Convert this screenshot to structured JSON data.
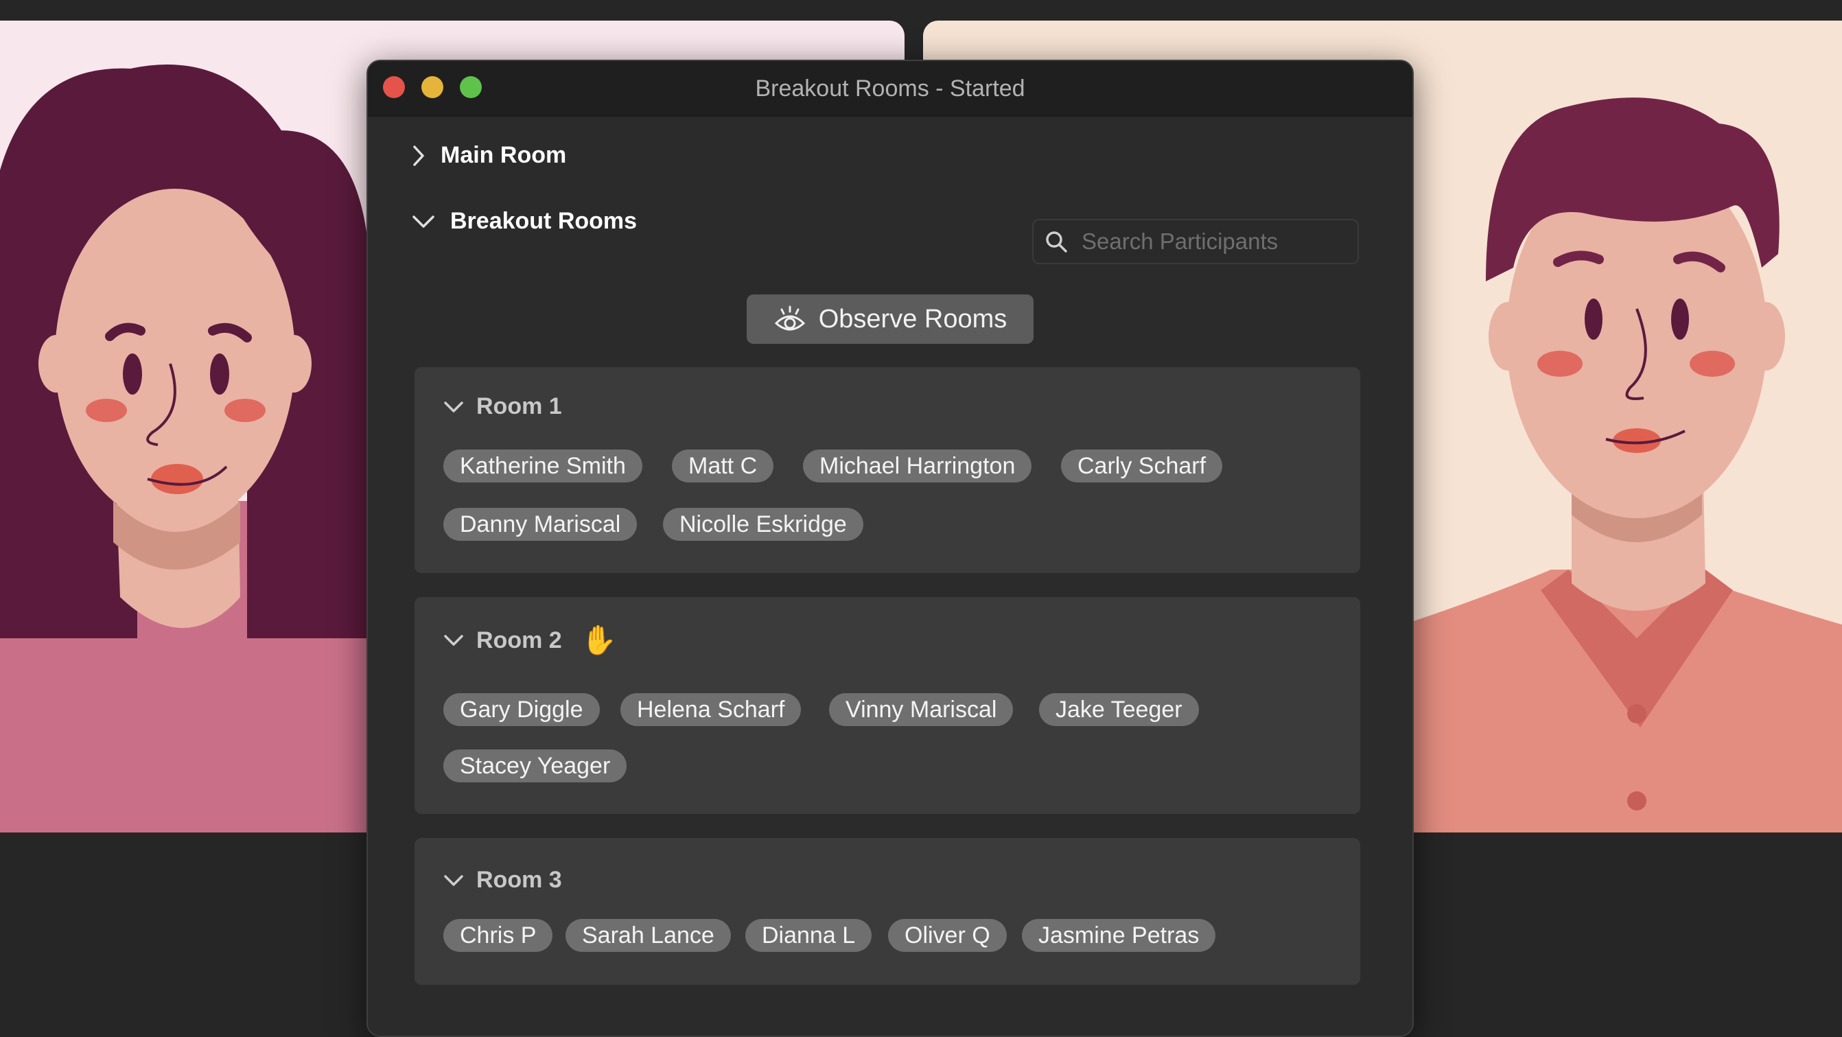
{
  "window": {
    "title": "Breakout Rooms - Started"
  },
  "sections": {
    "main_room": "Main Room",
    "breakout_rooms": "Breakout Rooms"
  },
  "search": {
    "placeholder": "Search Participants"
  },
  "observe_button": {
    "label": "Observe Rooms"
  },
  "rooms": [
    {
      "name": "Room 1",
      "hand_raised": false,
      "participants": [
        "Katherine Smith",
        "Matt C",
        "Michael Harrington",
        "Carly Scharf",
        "Danny Mariscal",
        "Nicolle Eskridge"
      ]
    },
    {
      "name": "Room 2",
      "hand_raised": true,
      "hand_icon": "✋",
      "participants": [
        "Gary Diggle",
        "Helena Scharf",
        "Vinny Mariscal",
        "Jake Teeger",
        "Stacey Yeager"
      ]
    },
    {
      "name": "Room 3",
      "hand_raised": false,
      "participants": [
        "Chris P",
        "Sarah Lance",
        "Dianna L",
        "Oliver Q",
        "Jasmine Petras"
      ]
    }
  ],
  "colors": {
    "close": "#e5534b",
    "minimize": "#e5b43a",
    "maximize": "#5fc24a",
    "window_bg": "#2b2b2b",
    "room_bg": "#3b3b3b",
    "chip_bg": "#6f6f6f"
  }
}
